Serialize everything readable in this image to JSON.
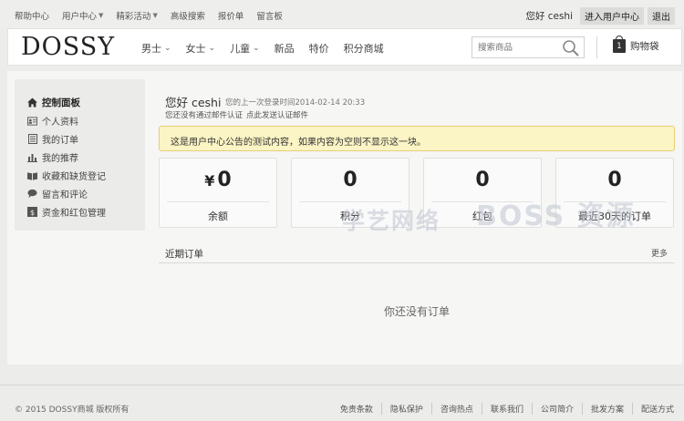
{
  "topbar": {
    "links": [
      {
        "label": "帮助中心",
        "dropdown": false
      },
      {
        "label": "用户中心",
        "dropdown": true
      },
      {
        "label": "精彩活动",
        "dropdown": true
      },
      {
        "label": "高级搜索",
        "dropdown": false
      },
      {
        "label": "报价单",
        "dropdown": false
      },
      {
        "label": "留言板",
        "dropdown": false
      }
    ],
    "greeting": "您好 ceshi",
    "user_center_button": "进入用户中心",
    "logout_button": "退出"
  },
  "header": {
    "logo": "DOSSY",
    "nav": [
      {
        "label": "男士",
        "dropdown": true
      },
      {
        "label": "女士",
        "dropdown": true
      },
      {
        "label": "儿童",
        "dropdown": true
      },
      {
        "label": "新品",
        "dropdown": false
      },
      {
        "label": "特价",
        "dropdown": false
      },
      {
        "label": "积分商城",
        "dropdown": false
      }
    ],
    "search_placeholder": "搜索商品",
    "cart_count": "1",
    "cart_label": "购物袋"
  },
  "sidebar": {
    "items": [
      {
        "label": "控制面板",
        "icon": "home-icon",
        "active": true
      },
      {
        "label": "个人资料",
        "icon": "id-card-icon",
        "active": false
      },
      {
        "label": "我的订单",
        "icon": "list-icon",
        "active": false
      },
      {
        "label": "我的推荐",
        "icon": "bar-chart-icon",
        "active": false
      },
      {
        "label": "收藏和缺货登记",
        "icon": "book-icon",
        "active": false
      },
      {
        "label": "留言和评论",
        "icon": "comment-icon",
        "active": false
      },
      {
        "label": "资金和红包管理",
        "icon": "money-icon",
        "active": false
      }
    ]
  },
  "welcome": {
    "greeting": "您好 ceshi",
    "last_login": "您的上一次登录时间2014-02-14 20:33",
    "verify_text": "您还没有通过邮件认证",
    "verify_link": "点此发送认证邮件"
  },
  "notice": "这是用户中心公告的测试内容，如果内容为空则不显示这一块。",
  "stats": [
    {
      "currency": "¥",
      "value": "0",
      "label": "余额"
    },
    {
      "currency": "",
      "value": "0",
      "label": "积分"
    },
    {
      "currency": "",
      "value": "0",
      "label": "红包"
    },
    {
      "currency": "",
      "value": "0",
      "label": "最近30天的订单"
    }
  ],
  "recent_orders": {
    "title": "近期订单",
    "more": "更多",
    "empty": "你还没有订单"
  },
  "watermark": {
    "line1": "学艺网络",
    "line2": "BOSS 资源"
  },
  "footer": {
    "copyright": "© 2015 DOSSY商城 版权所有",
    "links": [
      "免责条款",
      "隐私保护",
      "咨询热点",
      "联系我们",
      "公司简介",
      "批发方案",
      "配送方式"
    ]
  },
  "colors": {
    "notice_bg": "#fbf4c4",
    "notice_border": "#e6cf77",
    "page_bg": "#ececea",
    "panel_bg": "#f6f6f4"
  }
}
